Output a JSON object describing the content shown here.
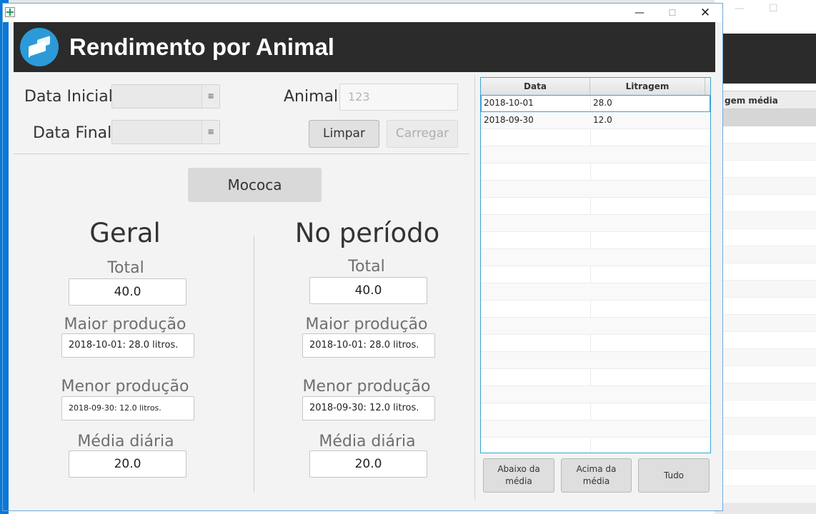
{
  "window": {
    "title": "",
    "controls": {
      "minimize": "—",
      "maximize": "☐",
      "close": "✕"
    }
  },
  "header": {
    "title": "Rendimento por Animal",
    "logo_icon": "dairy-box-icon"
  },
  "form": {
    "data_inicial_label": "Data Inicial",
    "data_final_label": "Data Final",
    "animal_label": "Animal",
    "animal_placeholder": "123",
    "limpar_button": "Limpar",
    "carregar_button": "Carregar",
    "calendar_icon": "calendar-icon"
  },
  "animal_name_button": "Mococa",
  "geral": {
    "title": "Geral",
    "total_label": "Total",
    "total_value": "40.0",
    "maior_label": "Maior produção",
    "maior_value": "2018-10-01: 28.0 litros.",
    "menor_label": "Menor produção",
    "menor_value": "2018-09-30: 12.0 litros.",
    "media_label": "Média diária",
    "media_value": "20.0"
  },
  "periodo": {
    "title": "No período",
    "total_label": "Total",
    "total_value": "40.0",
    "maior_label": "Maior produção",
    "maior_value": "2018-10-01: 28.0 litros.",
    "menor_label": "Menor produção",
    "menor_value": "2018-09-30: 12.0 litros.",
    "media_label": "Média diária",
    "media_value": "20.0"
  },
  "table": {
    "columns": [
      "Data",
      "Litragem"
    ],
    "rows": [
      {
        "data": "2018-10-01",
        "litragem": "28.0"
      },
      {
        "data": "2018-09-30",
        "litragem": "12.0"
      }
    ]
  },
  "filter_buttons": {
    "abaixo_line1": "Abaixo da",
    "abaixo_line2": "média",
    "acima_line1": "Acima da",
    "acima_line2": "média",
    "tudo": "Tudo"
  },
  "background_window": {
    "column_header": "gem média",
    "controls": {
      "minimize": "—",
      "maximize": "☐"
    }
  },
  "colors": {
    "accent_blue": "#0a78d7",
    "header_dark": "#2b2b2b",
    "table_border": "#3aa3d6"
  }
}
